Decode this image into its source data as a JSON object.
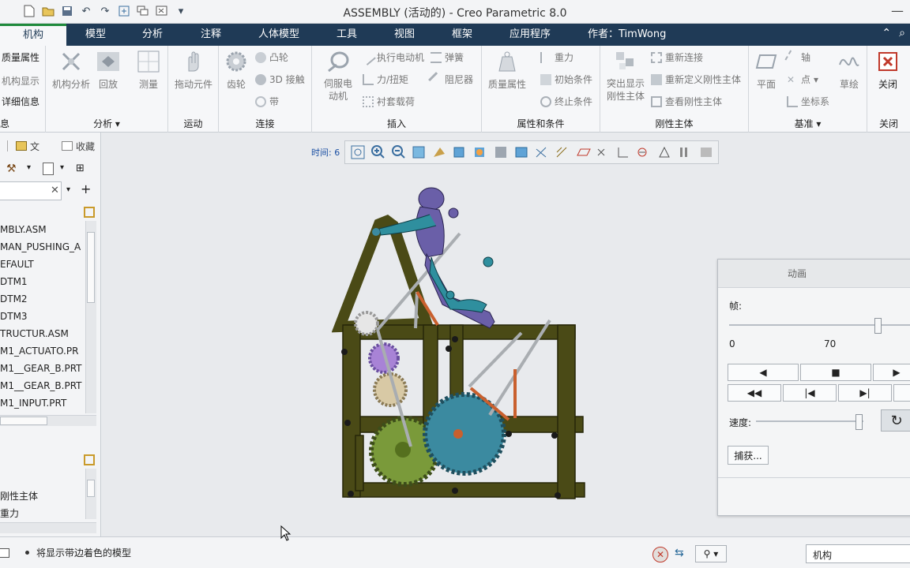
{
  "title_bar": {
    "title": "ASSEMBLY (活动的) - Creo Parametric 8.0"
  },
  "tabs": [
    {
      "label": "机构",
      "active": true
    },
    {
      "label": "模型"
    },
    {
      "label": "分析"
    },
    {
      "label": "注释"
    },
    {
      "label": "人体模型"
    },
    {
      "label": "工具"
    },
    {
      "label": "视图"
    },
    {
      "label": "框架"
    },
    {
      "label": "应用程序"
    }
  ],
  "author_tab": "作者：TimWong",
  "ribbon": {
    "g0": {
      "items": [
        "质量属性",
        "机构显示",
        "详细信息"
      ],
      "label": "息"
    },
    "g1": {
      "buttons": [
        "机构分析",
        "回放",
        "测量"
      ],
      "label": "分析"
    },
    "g2": {
      "button": "拖动元件",
      "label": "运动"
    },
    "g3": {
      "big": "齿轮",
      "items": [
        "凸轮",
        "3D 接触",
        "带"
      ],
      "label": "连接"
    },
    "g4": {
      "big": "伺服电动机",
      "items": [
        "执行电动机",
        "力/扭矩",
        "衬套载荷",
        "弹簧",
        "阻尼器"
      ],
      "label": "插入"
    },
    "g5": {
      "big": "质量属性",
      "items": [
        "重力",
        "初始条件",
        "终止条件"
      ],
      "label": "属性和条件"
    },
    "g6": {
      "big": "突出显示刚性主体",
      "items": [
        "重新连接",
        "重新定义刚性主体",
        "查看刚性主体"
      ],
      "label": "刚性主体"
    },
    "g7": {
      "big1": "平面",
      "items": [
        "轴",
        "点",
        "坐标系"
      ],
      "big2": "草绘",
      "label": "基准"
    },
    "g8": {
      "big": "关闭",
      "label": "关闭"
    }
  },
  "left_panel": {
    "tabs": [
      "文",
      "收藏"
    ],
    "tree": [
      "MBLY.ASM",
      "MAN_PUSHING_A",
      "EFAULT",
      "DTM1",
      "DTM2",
      "DTM3",
      "TRUCTUR.ASM",
      "M1_ACTUATO.PR",
      "M1__GEAR_B.PRT",
      "M1__GEAR_B.PRT",
      "M1_INPUT.PRT"
    ],
    "lower_items": [
      "刚性主体",
      "重力"
    ]
  },
  "view_toolbar": {
    "time_label": "时间: 6"
  },
  "animation_dialog": {
    "title": "动画",
    "frame_label": "帧:",
    "frame_min": "0",
    "frame_value": "70",
    "speed_label": "速度:",
    "capture_button": "捕获..."
  },
  "status_bar": {
    "message": "将显示带边着色的模型",
    "filter_value": "机构"
  },
  "colors": {
    "tab_bar": "#1f3a56",
    "active_tab_accent": "#1f8a3c",
    "frame": "#4a4a16",
    "human": "#6a5fa8",
    "human_leg": "#2f8f9e",
    "gear_green": "#7a9a3a",
    "gear_blue": "#3b8aa0",
    "linkage_orange": "#c9602e"
  }
}
